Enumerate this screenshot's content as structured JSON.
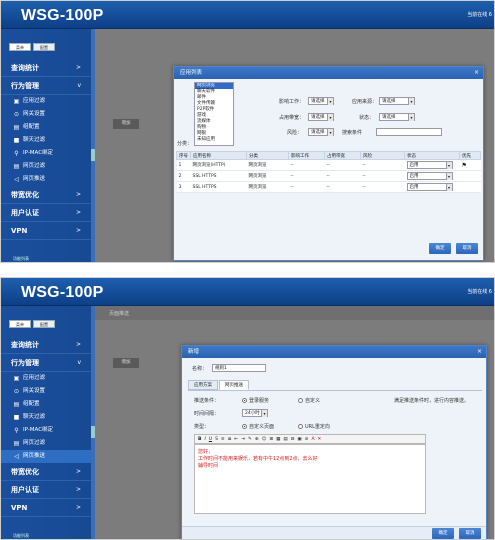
{
  "brand": "WSG-100P",
  "topright": "当前在线 6",
  "sidebar": {
    "tabs": [
      "菜单",
      "配置"
    ],
    "groups": [
      {
        "label": "查询统计",
        "arrow": ">"
      },
      {
        "label": "行为管理",
        "arrow": "v"
      }
    ],
    "subitems": [
      {
        "label": "应用过滤",
        "icon": "▣"
      },
      {
        "label": "网关设置",
        "icon": "⊙"
      },
      {
        "label": "组配置",
        "icon": "▤"
      },
      {
        "label": "聊天过滤",
        "icon": "■"
      },
      {
        "label": "IP-MAC绑定",
        "icon": "⚲"
      },
      {
        "label": "网页过滤",
        "icon": "▤"
      },
      {
        "label": "网页推送",
        "icon": "◁"
      }
    ],
    "groups_after": [
      {
        "label": "带宽优化",
        "arrow": ">"
      },
      {
        "label": "用户认证",
        "arrow": ">"
      },
      {
        "label": "VPN",
        "arrow": ">"
      }
    ],
    "footer": "功能列表"
  },
  "content_btn": "增加",
  "content_head": "页面推送",
  "dialog1": {
    "title": "应用列表",
    "list": [
      "网页浏览",
      "聊天软件",
      "邮件",
      "文件传输",
      "P2P软件",
      "游戏",
      "流媒体",
      "购物",
      "网银",
      "未知应用"
    ],
    "list_label": "分类：",
    "filters": {
      "impact_label": "影响工作：",
      "impact_val": "请选择",
      "source_label": "应用来源：",
      "source_val": "请选择",
      "usage_label": "占用带宽：",
      "usage_val": "请选择",
      "status_label": "状态：",
      "status_val": "请选择",
      "risk_label": "风险：",
      "risk_val": "请选择",
      "search_label": "搜索条件"
    },
    "columns": [
      "序号",
      "应用名称",
      "分类",
      "影响工作",
      "占用带宽",
      "风险",
      "状态",
      "优先"
    ],
    "rows": [
      {
        "no": "1",
        "name": "网页浏览(HTTP)",
        "cat": "网页浏览",
        "impact": "--",
        "bw": "--",
        "risk": "--",
        "status": "启用"
      },
      {
        "no": "2",
        "name": "SSL HTTPS",
        "cat": "网页浏览",
        "impact": "--",
        "bw": "--",
        "risk": "--",
        "status": "启用"
      },
      {
        "no": "3",
        "name": "SSL HTTPS",
        "cat": "网页浏览",
        "impact": "--",
        "bw": "--",
        "risk": "--",
        "status": "启用"
      }
    ],
    "ok": "确定",
    "cancel": "取消"
  },
  "dialog2": {
    "title": "新增",
    "name_label": "名称：",
    "name_val": "规则1",
    "tabs": [
      "应用方案",
      "网页推送"
    ],
    "push_label": "推送条件：",
    "opt1": "登录服务",
    "opt2": "自定义",
    "note": "满足推送条件时，进行内容推送。",
    "interval_label": "时间间隔：",
    "interval_val": "24小时",
    "type_label": "类型：",
    "type1": "自定义页面",
    "type2": "URL重定向",
    "toolbar": [
      "B",
      "I",
      "U",
      "S",
      "≡",
      "≣",
      "⇤",
      "⇥",
      "✎",
      "⊕",
      "☺",
      "⊞",
      "▦",
      "▤",
      "⊟",
      "▣",
      "⊘",
      "A",
      "✕"
    ],
    "editor_lines": [
      "您好，",
      "工作时间不能用来娱乐，若有中午12点到2点，去么好",
      "辅导时间"
    ],
    "ok": "确定",
    "cancel": "取消"
  }
}
